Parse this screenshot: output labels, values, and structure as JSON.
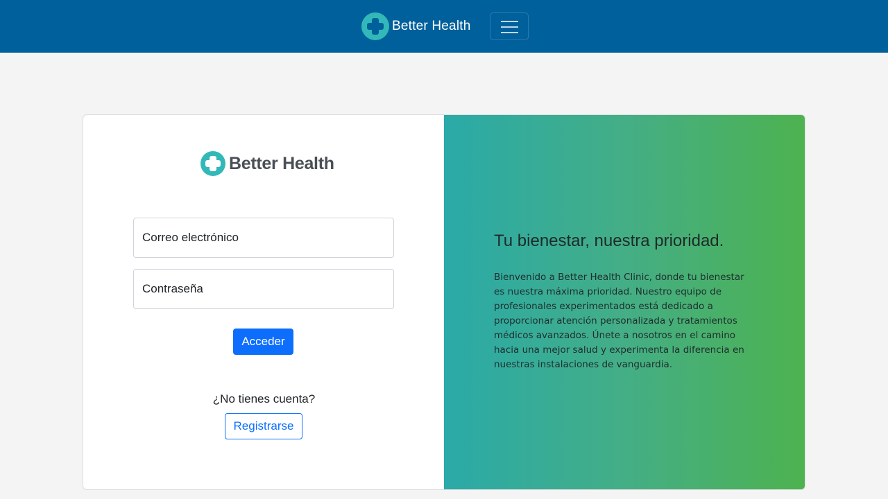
{
  "navbar": {
    "brand_name": "Better Health",
    "brand_icon": "medical-cross-icon",
    "toggler_icon": "hamburger-menu-icon",
    "background_color": "#00609c"
  },
  "login": {
    "logo_text": "Better Health",
    "logo_icon": "medical-cross-icon",
    "email_placeholder": "Correo electrónico",
    "password_placeholder": "Contraseña",
    "submit_label": "Acceder",
    "signup_question": "¿No tienes cuenta?",
    "signup_label": "Registrarse",
    "accent_color": "#0d6efd"
  },
  "promo": {
    "heading": "Tu bienestar, nuestra prioridad.",
    "body": "Bienvenido a Better Health Clinic, donde tu bienestar es nuestra máxima prioridad. Nuestro equipo de profesionales experimentados está dedicado a proporcionar atención personalizada y tratamientos médicos avanzados. Únete a nosotros en el camino hacia una mejor salud y experimenta la diferencia en nuestras instalaciones de vanguardia.",
    "gradient_start": "#2aaaa8",
    "gradient_end": "#4db24f"
  }
}
